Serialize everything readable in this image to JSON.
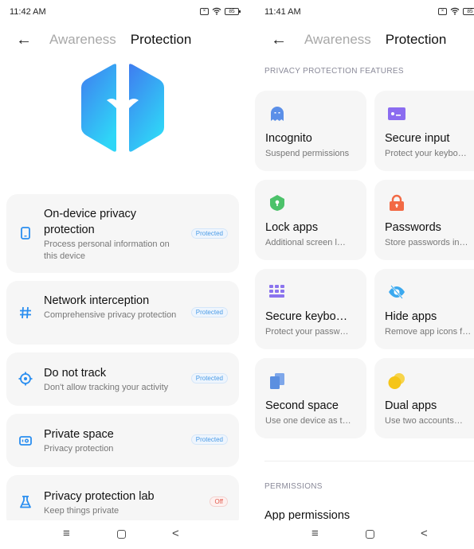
{
  "left_screen": {
    "status_bar": {
      "time": "11:42 AM",
      "sim_label": "×",
      "battery": "85"
    },
    "header": {
      "back_icon": "arrow-left-icon",
      "tab_awareness": "Awareness",
      "tab_protection": "Protection",
      "active_tab": "Protection"
    },
    "hero_icon": "security-hexagon-logo",
    "items": [
      {
        "icon": "phone-icon",
        "title": "On-device privacy protection",
        "subtitle": "Process personal information on this device",
        "status": "Protected"
      },
      {
        "icon": "hashtag-icon",
        "title": "Network interception",
        "subtitle": "Comprehensive privacy protection",
        "status": "Protected"
      },
      {
        "icon": "target-icon",
        "title": "Do not track",
        "subtitle": "Don't allow tracking your activity",
        "status": "Protected"
      },
      {
        "icon": "safe-icon",
        "title": "Private space",
        "subtitle": "Privacy protection",
        "status": "Protected"
      },
      {
        "icon": "flask-icon",
        "title": "Privacy protection lab",
        "subtitle": "Keep things private",
        "status": "Off"
      }
    ]
  },
  "right_screen": {
    "status_bar": {
      "time": "11:41 AM",
      "sim_label": "×",
      "battery": "85"
    },
    "header": {
      "back_icon": "arrow-left-icon",
      "tab_awareness": "Awareness",
      "tab_protection": "Protection",
      "active_tab": "Protection"
    },
    "section_features": "PRIVACY PROTECTION FEATURES",
    "features": [
      {
        "icon": "ghost-icon",
        "title": "Incognito",
        "subtitle": "Suspend permissions",
        "color": "#5b8fe8"
      },
      {
        "icon": "terminal-icon",
        "title": "Secure input",
        "subtitle": "Protect your keybo…",
        "color": "#8b6cf0"
      },
      {
        "icon": "shield-lock-icon",
        "title": "Lock apps",
        "subtitle": "Additional screen l…",
        "color": "#4cc26a"
      },
      {
        "icon": "padlock-icon",
        "title": "Passwords",
        "subtitle": "Store passwords in…",
        "color": "#f26a45"
      },
      {
        "icon": "keypad-icon",
        "title": "Secure keybo…",
        "subtitle": "Protect your passw…",
        "color": "#8b74ee"
      },
      {
        "icon": "eye-off-icon",
        "title": "Hide apps",
        "subtitle": "Remove app icons f…",
        "color": "#3ba9ef"
      },
      {
        "icon": "copy-icon",
        "title": "Second space",
        "subtitle": "Use one device as t…",
        "color": "#5b8fe0"
      },
      {
        "icon": "dual-circles-icon",
        "title": "Dual apps",
        "subtitle": "Use two accounts…",
        "color": "#f5c518"
      }
    ],
    "section_permissions": "PERMISSIONS",
    "permissions_items": [
      {
        "title": "App permissions"
      }
    ]
  },
  "navbar": {
    "menu": "≡",
    "home": "",
    "back": "<"
  },
  "colors": {
    "accent": "#2a8ef0",
    "protected_badge": "#4a9be6",
    "off_badge": "#e2584a",
    "card_bg": "#f6f6f6"
  }
}
